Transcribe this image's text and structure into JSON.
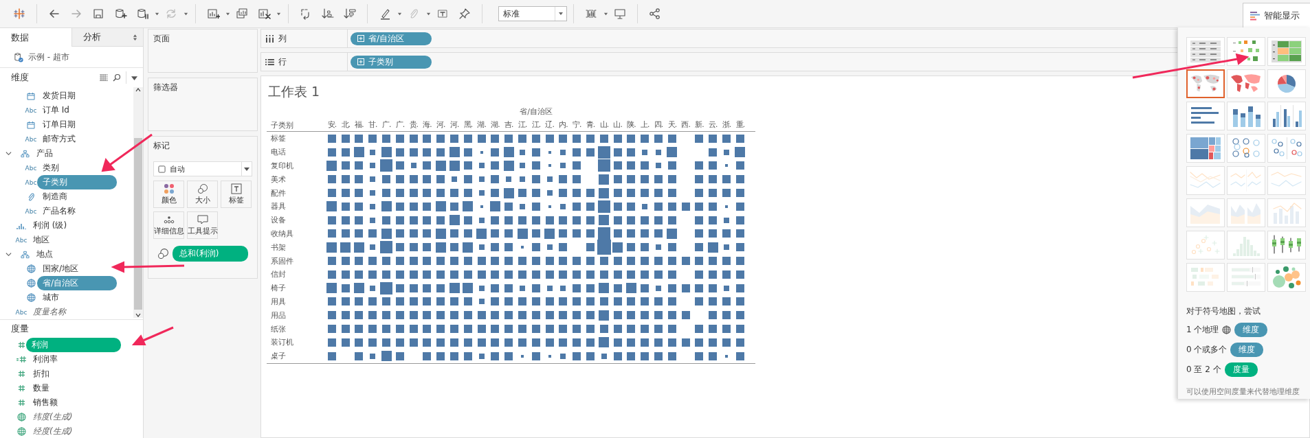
{
  "toolbar": {
    "view_mode": "标准"
  },
  "show_me_tab": {
    "label": "智能显示",
    "selected": true
  },
  "data_pane": {
    "tabs": [
      {
        "label": "数据",
        "selected": true
      },
      {
        "label": "分析",
        "selected": false
      }
    ],
    "datasource": "示例 - 超市",
    "dimensions": {
      "title": "维度",
      "items": [
        {
          "children": [
            {
              "kind": "date",
              "label": "发货日期",
              "selected": false,
              "generated": false
            },
            {
              "kind": "string",
              "type_label": "Abc",
              "label": "订单 Id",
              "selected": false,
              "generated": false
            },
            {
              "kind": "date",
              "label": "订单日期",
              "selected": false,
              "generated": false
            },
            {
              "kind": "string",
              "type_label": "Abc",
              "label": "邮寄方式",
              "selected": false,
              "generated": false
            }
          ]
        },
        {
          "kind": "hierarchy",
          "label": "产品",
          "expanded": true,
          "children": [
            {
              "kind": "string",
              "type_label": "Abc",
              "label": "类别",
              "selected": false,
              "generated": false
            },
            {
              "kind": "string",
              "type_label": "Abc",
              "label": "子类别",
              "selected": true,
              "generated": false
            },
            {
              "kind": "clip",
              "label": "制造商",
              "selected": false,
              "generated": false
            },
            {
              "kind": "string",
              "type_label": "Abc",
              "label": "产品名称",
              "selected": false,
              "generated": false
            }
          ]
        },
        {
          "kind": "bins",
          "label": "利润 (级)",
          "selected": false,
          "generated": false
        },
        {
          "kind": "string",
          "type_label": "Abc",
          "label": "地区",
          "selected": false,
          "generated": false
        },
        {
          "kind": "hierarchy",
          "label": "地点",
          "expanded": true,
          "children": [
            {
              "kind": "geo",
              "label": "国家/地区",
              "selected": false,
              "generated": false
            },
            {
              "kind": "geo",
              "label": "省/自治区",
              "selected": true,
              "generated": false
            },
            {
              "kind": "geo",
              "label": "城市",
              "selected": false,
              "generated": false
            }
          ]
        },
        {
          "kind": "string",
          "type_label": "Abc",
          "label": "度量名称",
          "selected": false,
          "generated": true
        }
      ]
    },
    "measures": {
      "title": "度量",
      "items": [
        {
          "kind": "measure",
          "label": "利润",
          "selected": true,
          "generated": false
        },
        {
          "kind": "calculated",
          "label": "利润率",
          "selected": false,
          "generated": false
        },
        {
          "kind": "measure",
          "label": "折扣",
          "selected": false,
          "generated": false
        },
        {
          "kind": "measure",
          "label": "数量",
          "selected": false,
          "generated": false
        },
        {
          "kind": "measure",
          "label": "销售额",
          "selected": false,
          "generated": false
        },
        {
          "kind": "geo",
          "label": "纬度(生成)",
          "selected": false,
          "generated": true
        },
        {
          "kind": "geo",
          "label": "经度(生成)",
          "selected": false,
          "generated": true
        }
      ]
    }
  },
  "pages_card": {
    "title": "页面"
  },
  "filters_card": {
    "title": "筛选器"
  },
  "marks_card": {
    "title": "标记",
    "mark_type": "自动",
    "buttons": [
      {
        "kind": "color",
        "label": "颜色"
      },
      {
        "kind": "size",
        "label": "大小"
      },
      {
        "kind": "label",
        "label": "标签"
      },
      {
        "kind": "detail",
        "label": "详细信息"
      },
      {
        "kind": "tooltip",
        "label": "工具提示"
      }
    ],
    "fields": [
      {
        "kind": "size",
        "pill": "总和(利润)",
        "measure": true
      }
    ]
  },
  "shelves": [
    {
      "kind": "columns",
      "label": "列",
      "pill": "省/自治区",
      "measure": false
    },
    {
      "kind": "rows",
      "label": "行",
      "pill": "子类别",
      "measure": false
    }
  ],
  "worksheet": {
    "title": "工作表 1",
    "column_title": "省/自治区",
    "row_header": "子类别",
    "columns": [
      "安.",
      "北.",
      "福.",
      "甘.",
      "广.",
      "广.",
      "贵.",
      "海.",
      "河.",
      "河.",
      "黑.",
      "湖.",
      "湖.",
      "吉.",
      "江.",
      "江.",
      "辽.",
      "内.",
      "宁.",
      "青.",
      "山.",
      "山.",
      "陕.",
      "上.",
      "四.",
      "天.",
      "西.",
      "新.",
      "云.",
      "浙.",
      "重."
    ],
    "rows": [
      {
        "label": "标签"
      },
      {
        "label": "电话"
      },
      {
        "label": "复印机"
      },
      {
        "label": "美术"
      },
      {
        "label": "配件"
      },
      {
        "label": "器具"
      },
      {
        "label": "设备"
      },
      {
        "label": "收纳具"
      },
      {
        "label": "书架"
      },
      {
        "label": "系固件"
      },
      {
        "label": "信封"
      },
      {
        "label": "椅子"
      },
      {
        "label": "用具"
      },
      {
        "label": "用品"
      },
      {
        "label": "纸张"
      },
      {
        "label": "装订机"
      },
      {
        "label": "桌子"
      }
    ]
  },
  "show_me": {
    "thumbnails": [
      {
        "kind": "text-table",
        "available": true,
        "selected": false
      },
      {
        "kind": "heat-map",
        "available": true,
        "selected": false
      },
      {
        "kind": "highlight-table",
        "available": true,
        "selected": false
      },
      {
        "kind": "symbol-map",
        "available": true,
        "selected": true
      },
      {
        "kind": "filled-map",
        "available": true,
        "selected": false
      },
      {
        "kind": "pie-chart",
        "available": true,
        "selected": false
      },
      {
        "kind": "horizontal-bar",
        "available": true,
        "selected": false
      },
      {
        "kind": "stacked-bar",
        "available": true,
        "selected": false
      },
      {
        "kind": "side-by-side-bar",
        "available": true,
        "selected": false
      },
      {
        "kind": "treemap",
        "available": true,
        "selected": false
      },
      {
        "kind": "circle-view",
        "available": true,
        "selected": false
      },
      {
        "kind": "side-by-side-circle",
        "available": true,
        "selected": false
      },
      {
        "kind": "line-chart",
        "available": false,
        "selected": false
      },
      {
        "kind": "split-line-chart",
        "available": false,
        "selected": false
      },
      {
        "kind": "dual-line-chart",
        "available": false,
        "selected": false
      },
      {
        "kind": "area-chart",
        "available": false,
        "selected": false
      },
      {
        "kind": "split-area-chart",
        "available": false,
        "selected": false
      },
      {
        "kind": "bar-line-chart",
        "available": false,
        "selected": false
      },
      {
        "kind": "scatter-plot",
        "available": false,
        "selected": false
      },
      {
        "kind": "histogram",
        "available": false,
        "selected": false
      },
      {
        "kind": "box-plot",
        "available": true,
        "selected": false
      },
      {
        "kind": "gantt-chart",
        "available": false,
        "selected": false
      },
      {
        "kind": "bullet-chart",
        "available": false,
        "selected": false
      },
      {
        "kind": "bubble-chart",
        "available": true,
        "selected": false
      }
    ],
    "hint_title": "对于符号地图，尝试",
    "requirements": [
      {
        "text": "1 个地理",
        "geo_icon": true,
        "pill": "维度",
        "measure": false
      },
      {
        "text": "0 个或多个",
        "geo_icon": false,
        "pill": "维度",
        "measure": false
      },
      {
        "text": "0 至 2 个",
        "geo_icon": false,
        "pill": "度量",
        "measure": true
      }
    ],
    "note": "可以使用空间度量来代替地理维度"
  }
}
